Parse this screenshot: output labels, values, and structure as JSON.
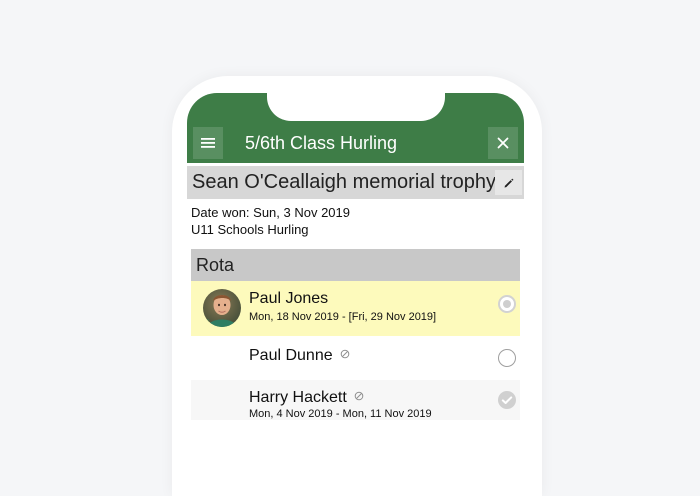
{
  "app": {
    "title": "5/6th Class Hurling",
    "menu_icon": "menu-icon",
    "close_icon": "close-icon",
    "accent_color": "#3e7d47"
  },
  "trophy": {
    "title": "Sean O'Ceallaigh memorial trophy",
    "edit_icon": "pencil-icon",
    "date_won": "Date won: Sun, 3 Nov 2019",
    "competition": "U11 Schools Hurling"
  },
  "rota": {
    "title": "Rota",
    "rows": [
      {
        "name": "Paul Jones",
        "dates": "Mon, 18 Nov 2019 - [Fri, 29 Nov 2019]",
        "has_avatar": true,
        "status": "current",
        "highlight_color": "#fdfabc"
      },
      {
        "name": "Paul Dunne",
        "dates": "",
        "has_avatar": false,
        "status": "pending",
        "inactive_icon": "not-available-icon"
      },
      {
        "name": "Harry Hackett",
        "dates": "Mon, 4 Nov 2019 - Mon, 11 Nov 2019",
        "has_avatar": false,
        "status": "completed",
        "inactive_icon": "not-available-icon"
      }
    ]
  }
}
